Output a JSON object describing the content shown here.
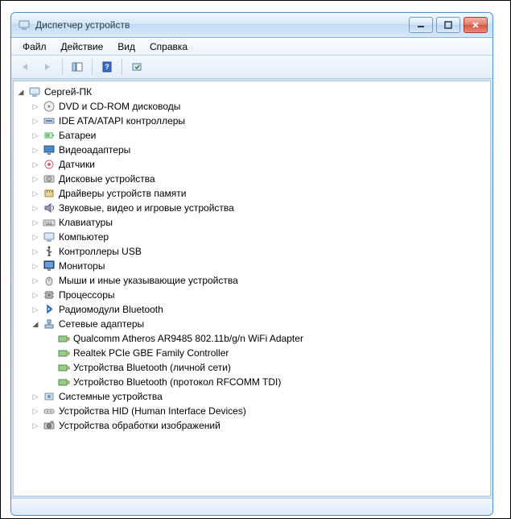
{
  "window": {
    "title": "Диспетчер устройств"
  },
  "menu": {
    "file": "Файл",
    "action": "Действие",
    "view": "Вид",
    "help": "Справка"
  },
  "tree": {
    "root": "Сергей-ПК",
    "categories": [
      {
        "label": "DVD и CD-ROM дисководы",
        "icon": "disc"
      },
      {
        "label": "IDE ATA/ATAPI контроллеры",
        "icon": "ide"
      },
      {
        "label": "Батареи",
        "icon": "battery"
      },
      {
        "label": "Видеоадаптеры",
        "icon": "display"
      },
      {
        "label": "Датчики",
        "icon": "sensor"
      },
      {
        "label": "Дисковые устройства",
        "icon": "hdd"
      },
      {
        "label": "Драйверы устройств памяти",
        "icon": "memdrv"
      },
      {
        "label": "Звуковые, видео и игровые устройства",
        "icon": "sound"
      },
      {
        "label": "Клавиатуры",
        "icon": "keyboard"
      },
      {
        "label": "Компьютер",
        "icon": "computer"
      },
      {
        "label": "Контроллеры USB",
        "icon": "usb"
      },
      {
        "label": "Мониторы",
        "icon": "monitor"
      },
      {
        "label": "Мыши и иные указывающие устройства",
        "icon": "mouse"
      },
      {
        "label": "Процессоры",
        "icon": "cpu"
      },
      {
        "label": "Радиомодули Bluetooth",
        "icon": "bluetooth"
      },
      {
        "label": "Сетевые адаптеры",
        "icon": "network",
        "expanded": true,
        "children": [
          {
            "label": "Qualcomm Atheros AR9485 802.11b/g/n WiFi Adapter",
            "icon": "nic"
          },
          {
            "label": "Realtek PCIe GBE Family Controller",
            "icon": "nic"
          },
          {
            "label": "Устройства Bluetooth (личной сети)",
            "icon": "nic"
          },
          {
            "label": "Устройство Bluetooth (протокол RFCOMM TDI)",
            "icon": "nic"
          }
        ]
      },
      {
        "label": "Системные устройства",
        "icon": "system"
      },
      {
        "label": "Устройства HID (Human Interface Devices)",
        "icon": "hid"
      },
      {
        "label": "Устройства обработки изображений",
        "icon": "imaging"
      }
    ]
  }
}
